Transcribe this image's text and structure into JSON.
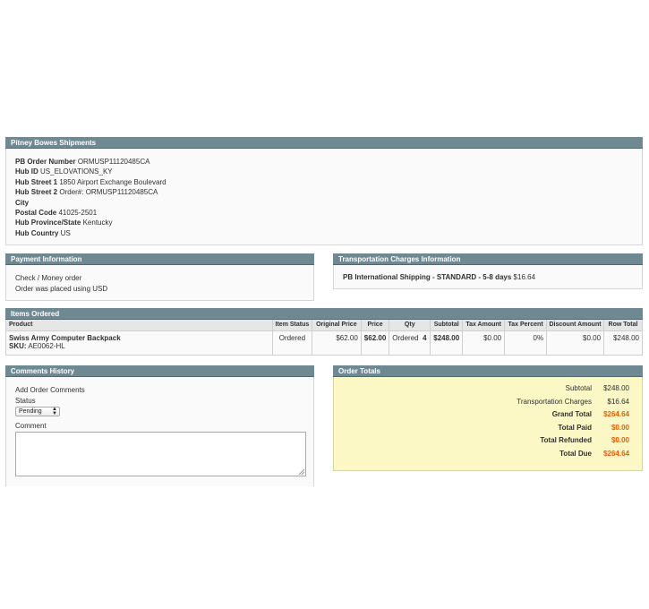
{
  "pitney_bowes": {
    "title": "Pitney Bowes Shipments",
    "rows": [
      {
        "label": "PB Order Number",
        "value": "ORMUSP11120485CA"
      },
      {
        "label": "Hub ID",
        "value": "US_ELOVATIONS_KY"
      },
      {
        "label": "Hub Street 1",
        "value": "1850 Airport Exchange Boulevard"
      },
      {
        "label": "Hub Street 2",
        "value": "Order#: ORMUSP11120485CA"
      },
      {
        "label": "City",
        "value": ""
      },
      {
        "label": "Postal Code",
        "value": "41025-2501"
      },
      {
        "label": "Hub Province/State",
        "value": "Kentucky"
      },
      {
        "label": "Hub Country",
        "value": "US"
      }
    ]
  },
  "payment": {
    "title": "Payment Information",
    "method": "Check / Money order",
    "note": "Order was placed using USD"
  },
  "transport": {
    "title": "Transportation Charges Information",
    "method": "PB International Shipping - STANDARD - 5-8 days",
    "price": "$16.64"
  },
  "items": {
    "title": "Items Ordered",
    "columns": [
      "Product",
      "Item Status",
      "Original Price",
      "Price",
      "Qty",
      "Subtotal",
      "Tax Amount",
      "Tax Percent",
      "Discount Amount",
      "Row Total"
    ],
    "rows": [
      {
        "product": "Swiss Army Computer Backpack",
        "sku_label": "SKU:",
        "sku": "AE0062-HL",
        "status": "Ordered",
        "original_price": "$62.00",
        "price": "$62.00",
        "qty_label": "Ordered",
        "qty": "4",
        "subtotal": "$248.00",
        "tax_amount": "$0.00",
        "tax_percent": "0%",
        "discount": "$0.00",
        "row_total": "$248.00"
      }
    ]
  },
  "comments": {
    "title": "Comments History",
    "add_label": "Add Order Comments",
    "status_label": "Status",
    "status_value": "Pending",
    "comment_label": "Comment"
  },
  "totals": {
    "title": "Order Totals",
    "rows": [
      {
        "label": "Subtotal",
        "value": "$248.00"
      },
      {
        "label": "Transportation Charges",
        "value": "$16.64"
      },
      {
        "label": "Grand Total",
        "value": "$264.64"
      },
      {
        "label": "Total Paid",
        "value": "$0.00"
      },
      {
        "label": "Total Refunded",
        "value": "$0.00"
      },
      {
        "label": "Total Due",
        "value": "$264.64"
      }
    ]
  },
  "colors": {
    "header_bg": "#6f8992",
    "totals_bg": "#fbf8c6",
    "accent_orange": "#eb5e00"
  }
}
